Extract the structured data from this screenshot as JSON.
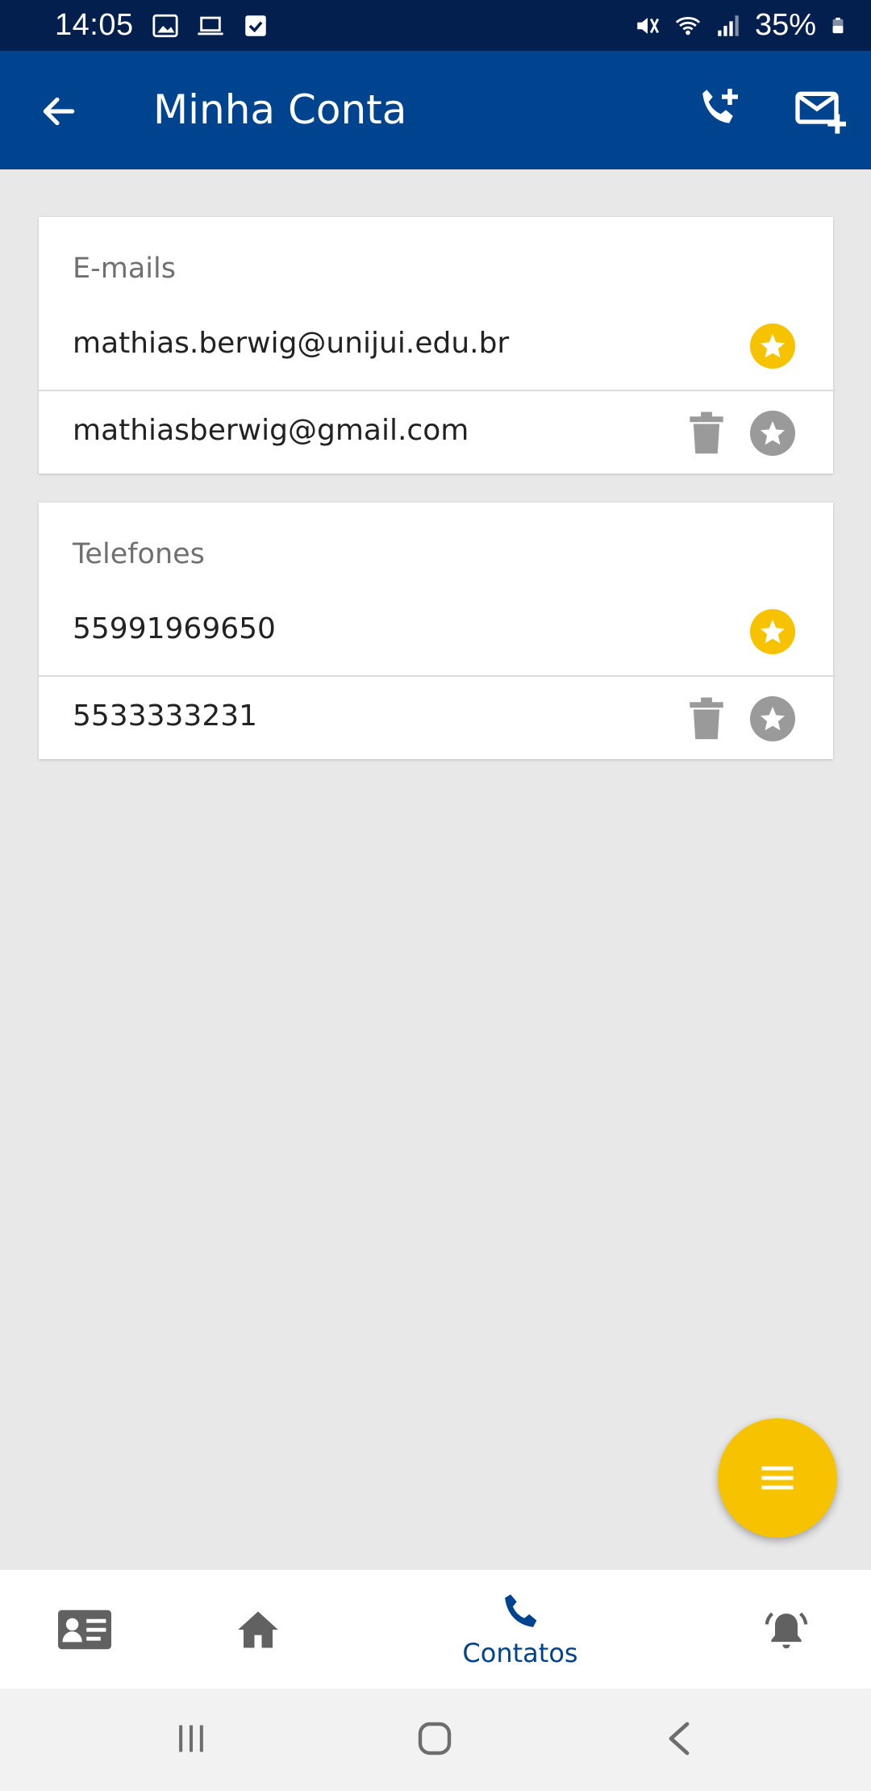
{
  "status_bar": {
    "time": "14:05",
    "battery": "35%",
    "icons": [
      "image-icon",
      "laptop-icon",
      "check-box-icon",
      "mute-icon",
      "wifi-icon",
      "signal-icon",
      "battery-icon"
    ]
  },
  "app_bar": {
    "title": "Minha Conta",
    "back_icon": "arrow-left-icon",
    "actions": [
      "add-phone-icon",
      "add-mail-icon"
    ]
  },
  "emails": {
    "header": "E-mails",
    "items": [
      {
        "value": "mathias.berwig@unijui.edu.br",
        "favorite": true,
        "deletable": false
      },
      {
        "value": "mathiasberwig@gmail.com",
        "favorite": false,
        "deletable": true
      }
    ]
  },
  "phones": {
    "header": "Telefones",
    "items": [
      {
        "value": "55991969650",
        "favorite": true,
        "deletable": false
      },
      {
        "value": "5533333231",
        "favorite": false,
        "deletable": true
      }
    ]
  },
  "fab": {
    "icon": "menu-icon"
  },
  "bottom_nav": {
    "items": [
      {
        "icon": "id-card-icon",
        "label": ""
      },
      {
        "icon": "home-icon",
        "label": ""
      },
      {
        "icon": "phone-icon",
        "label": "Contatos",
        "active": true
      },
      {
        "icon": "alarm-bell-icon",
        "label": ""
      }
    ]
  },
  "colors": {
    "status_bar": "#021f4e",
    "app_bar": "#00438f",
    "accent": "#f7c300",
    "inactive_icon": "#9a9a9a",
    "background": "#e8e8e8"
  }
}
